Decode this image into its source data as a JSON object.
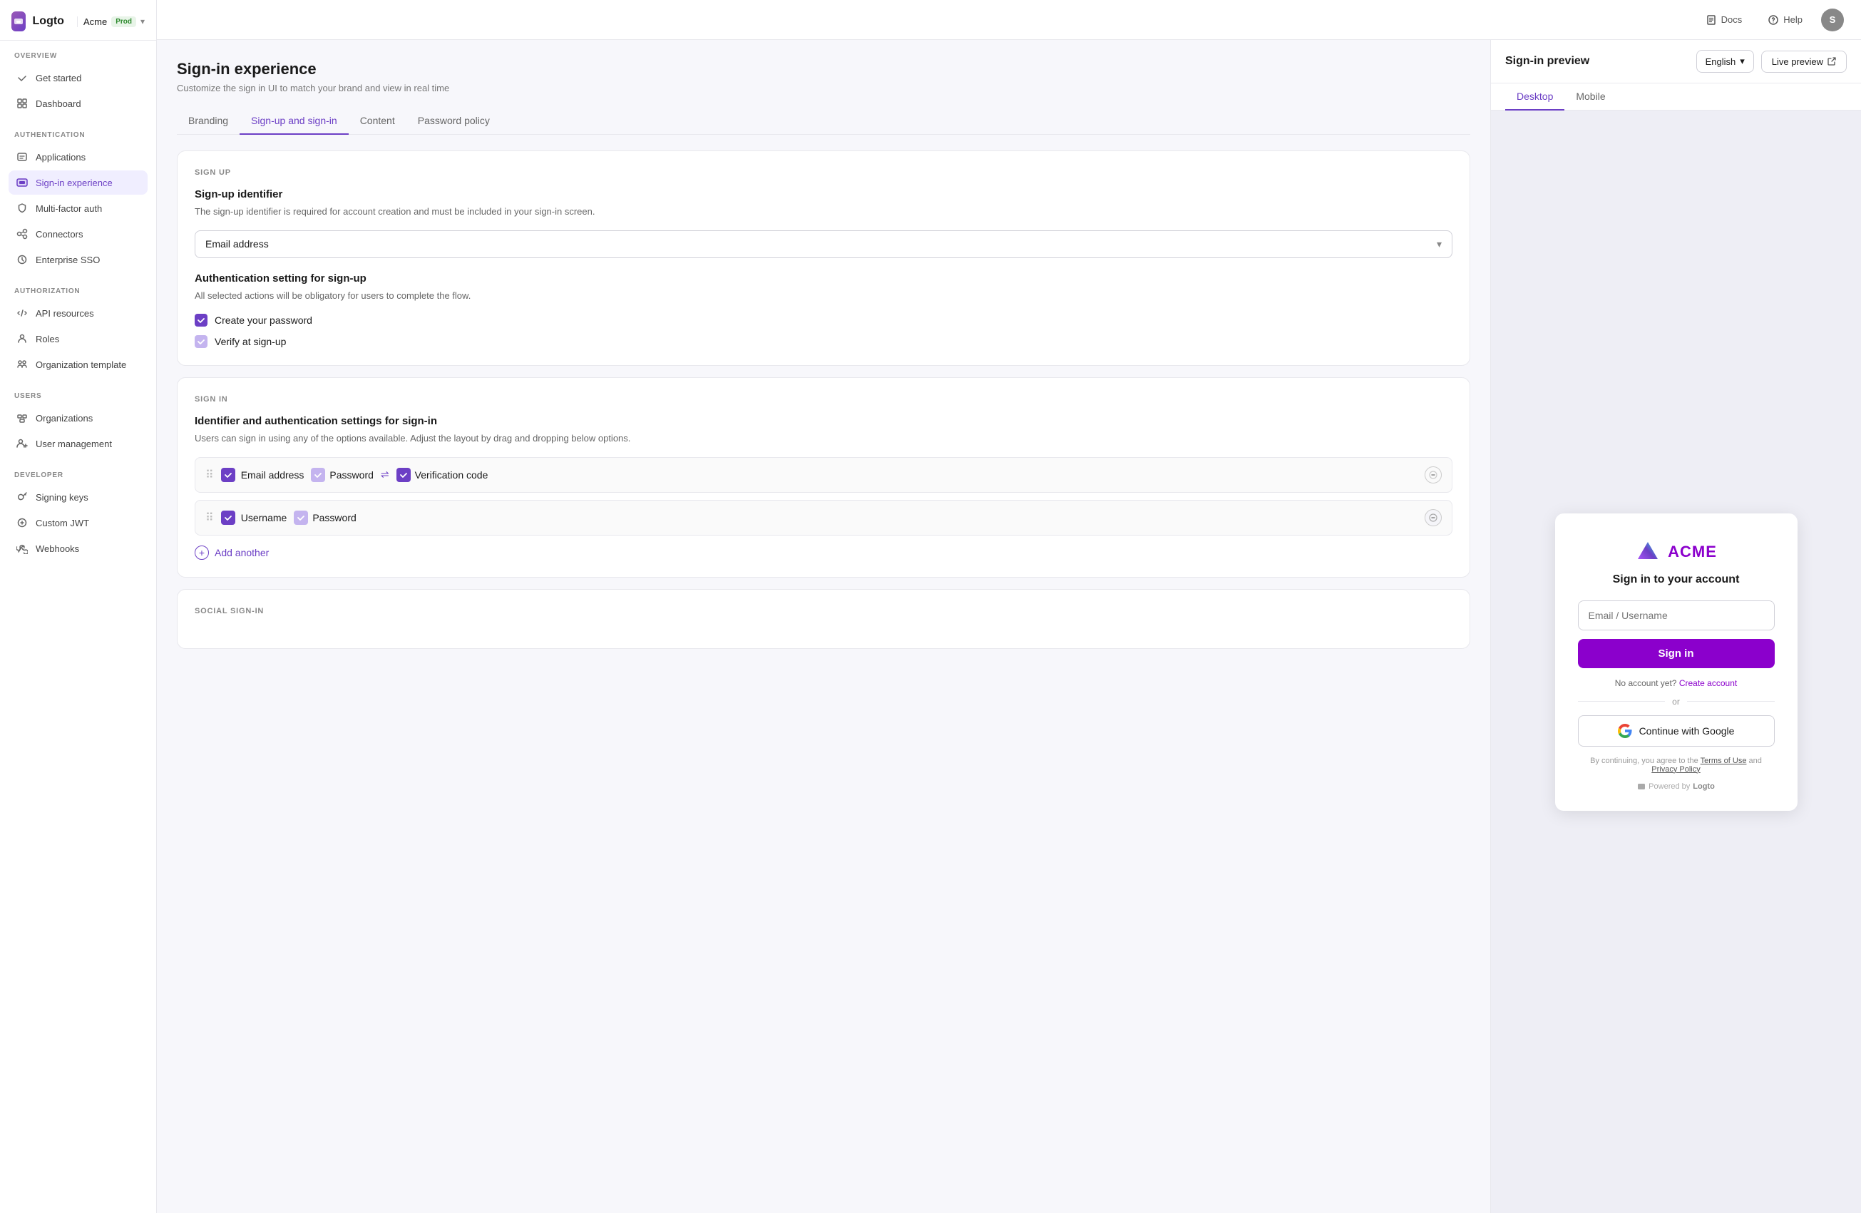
{
  "app": {
    "logo_text": "Logto",
    "org_name": "Acme",
    "org_badge": "Prod",
    "avatar_letter": "S"
  },
  "topbar": {
    "docs_label": "Docs",
    "help_label": "Help"
  },
  "sidebar": {
    "overview_label": "OVERVIEW",
    "get_started_label": "Get started",
    "dashboard_label": "Dashboard",
    "authentication_label": "AUTHENTICATION",
    "applications_label": "Applications",
    "signin_experience_label": "Sign-in experience",
    "mfa_label": "Multi-factor auth",
    "connectors_label": "Connectors",
    "enterprise_sso_label": "Enterprise SSO",
    "authorization_label": "AUTHORIZATION",
    "api_resources_label": "API resources",
    "roles_label": "Roles",
    "org_template_label": "Organization template",
    "users_label": "USERS",
    "organizations_label": "Organizations",
    "user_management_label": "User management",
    "developer_label": "DEVELOPER",
    "signing_keys_label": "Signing keys",
    "custom_jwt_label": "Custom JWT",
    "webhooks_label": "Webhooks"
  },
  "page": {
    "title": "Sign-in experience",
    "subtitle": "Customize the sign in UI to match your brand and view in real time"
  },
  "tabs": {
    "branding_label": "Branding",
    "signup_signin_label": "Sign-up and sign-in",
    "content_label": "Content",
    "password_policy_label": "Password policy"
  },
  "signup_section": {
    "section_label": "SIGN UP",
    "title": "Sign-up identifier",
    "desc": "The sign-up identifier is required for account creation and must be included in your sign-in screen.",
    "identifier_value": "Email address",
    "auth_title": "Authentication setting for sign-up",
    "auth_desc": "All selected actions will be obligatory for users to complete the flow.",
    "create_password_label": "Create your password",
    "verify_label": "Verify at sign-up"
  },
  "signin_section": {
    "section_label": "SIGN IN",
    "title": "Identifier and authentication settings for sign-in",
    "desc": "Users can sign in using any of the options available. Adjust the layout by drag and dropping below options.",
    "row1_method": "Email address",
    "row1_opt1": "Password",
    "row1_opt2": "Verification code",
    "row2_method": "Username",
    "row2_opt1": "Password",
    "add_another_label": "Add another"
  },
  "social_section": {
    "section_label": "SOCIAL SIGN-IN"
  },
  "preview": {
    "title": "Sign-in preview",
    "lang_label": "English",
    "live_preview_label": "Live preview",
    "tab_desktop": "Desktop",
    "tab_mobile": "Mobile",
    "brand_name": "ACME",
    "signin_title": "Sign in to your account",
    "input_placeholder": "Email / Username",
    "signin_btn": "Sign in",
    "no_account_text": "No account yet?",
    "create_account_text": "Create account",
    "or_text": "or",
    "google_btn": "Continue with Google",
    "terms_text": "By continuing, you agree to the",
    "terms_link": "Terms of Use",
    "and_text": "and",
    "privacy_link": "Privacy Policy",
    "powered_text": "Powered by",
    "logto_text": "Logto"
  }
}
